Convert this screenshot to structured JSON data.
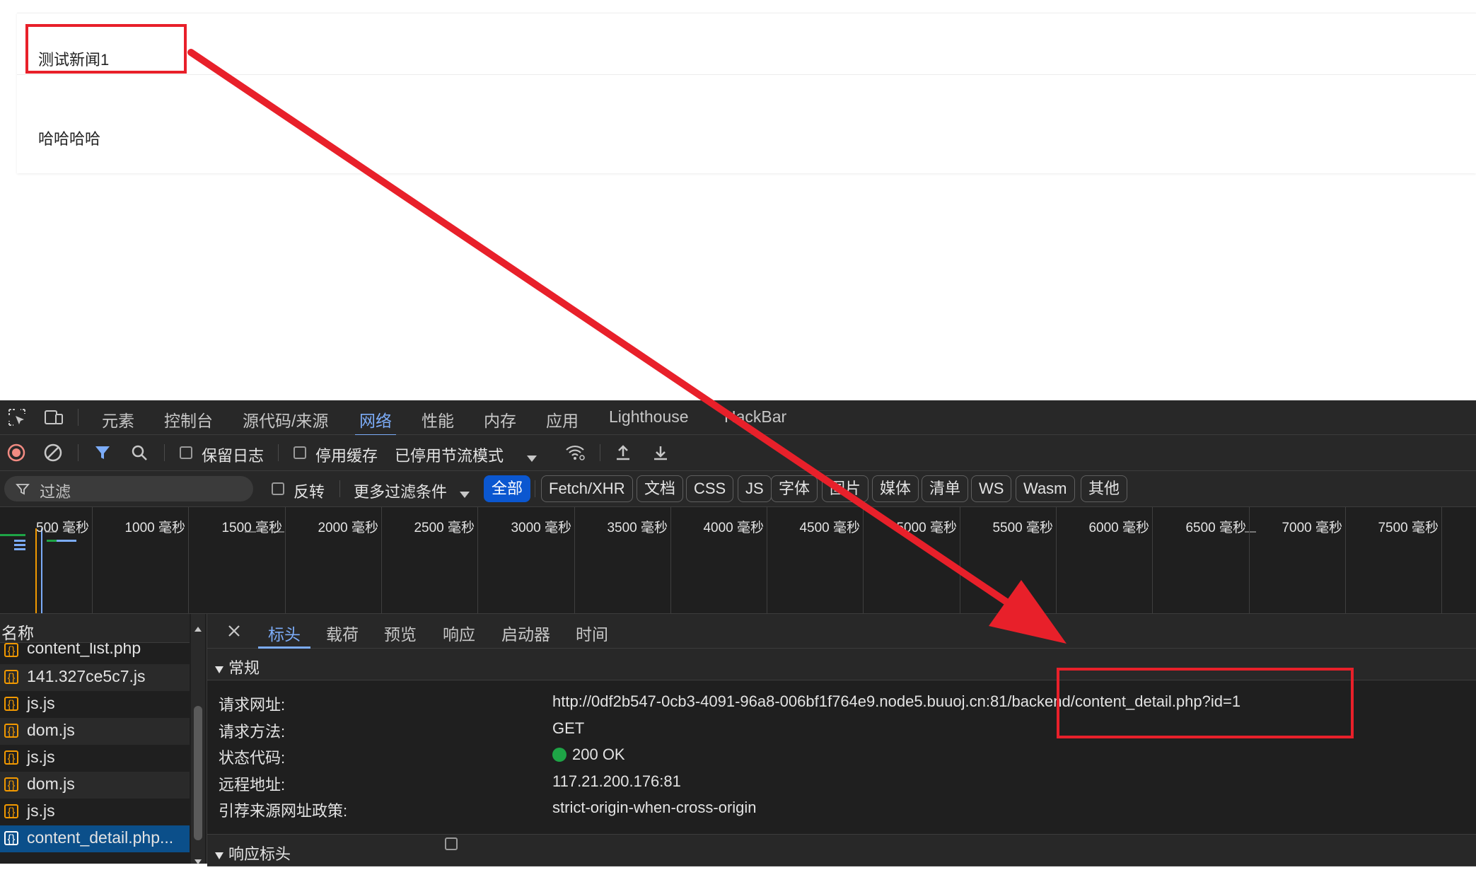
{
  "page": {
    "news_title": "测试新闻1",
    "news_body": "哈哈哈哈"
  },
  "devtools": {
    "main_tabs": [
      "元素",
      "控制台",
      "源代码/来源",
      "网络",
      "性能",
      "内存",
      "应用",
      "Lighthouse",
      "HackBar"
    ],
    "active_main_tab": "网络",
    "toolbar": {
      "preserve_log": "保留日志",
      "disable_cache": "停用缓存",
      "throttling": "已停用节流模式"
    },
    "filterbar": {
      "filter_placeholder": "过滤",
      "invert": "反转",
      "more_filters": "更多过滤条件",
      "chips": [
        "全部",
        "Fetch/XHR",
        "文档",
        "CSS",
        "JS",
        "字体",
        "图片",
        "媒体",
        "清单",
        "WS",
        "Wasm",
        "其他"
      ],
      "active_chip": "全部"
    },
    "timeline_ticks": [
      "500 毫秒",
      "1000 毫秒",
      "1500 毫秒",
      "2000 毫秒",
      "2500 毫秒",
      "3000 毫秒",
      "3500 毫秒",
      "4000 毫秒",
      "4500 毫秒",
      "5000 毫秒",
      "5500 毫秒",
      "6000 毫秒",
      "6500 毫秒",
      "7000 毫秒",
      "7500 毫秒"
    ],
    "request_list": {
      "header": "名称",
      "items": [
        "content_list.php",
        "141.327ce5c7.js",
        "js.js",
        "dom.js",
        "js.js",
        "dom.js",
        "js.js",
        "content_detail.php..."
      ],
      "selected": "content_detail.php..."
    },
    "detail_tabs": [
      "标头",
      "载荷",
      "预览",
      "响应",
      "启动器",
      "时间"
    ],
    "active_detail_tab": "标头",
    "general": {
      "section_title": "常规",
      "labels": [
        "请求网址:",
        "请求方法:",
        "状态代码:",
        "远程地址:",
        "引荐来源网址政策:"
      ],
      "request_url": "http://0df2b547-0cb3-4091-96a8-006bf1f764e9.node5.buuoj.cn:81/backend/content_detail.php?id=1",
      "method": "GET",
      "status": "200 OK",
      "remote_address": "117.21.200.176:81",
      "referrer_policy": "strict-origin-when-cross-origin"
    },
    "response_headers_title": "响应标头",
    "status_color": "#1ea446"
  },
  "annotation": {
    "color": "#e8202a"
  }
}
